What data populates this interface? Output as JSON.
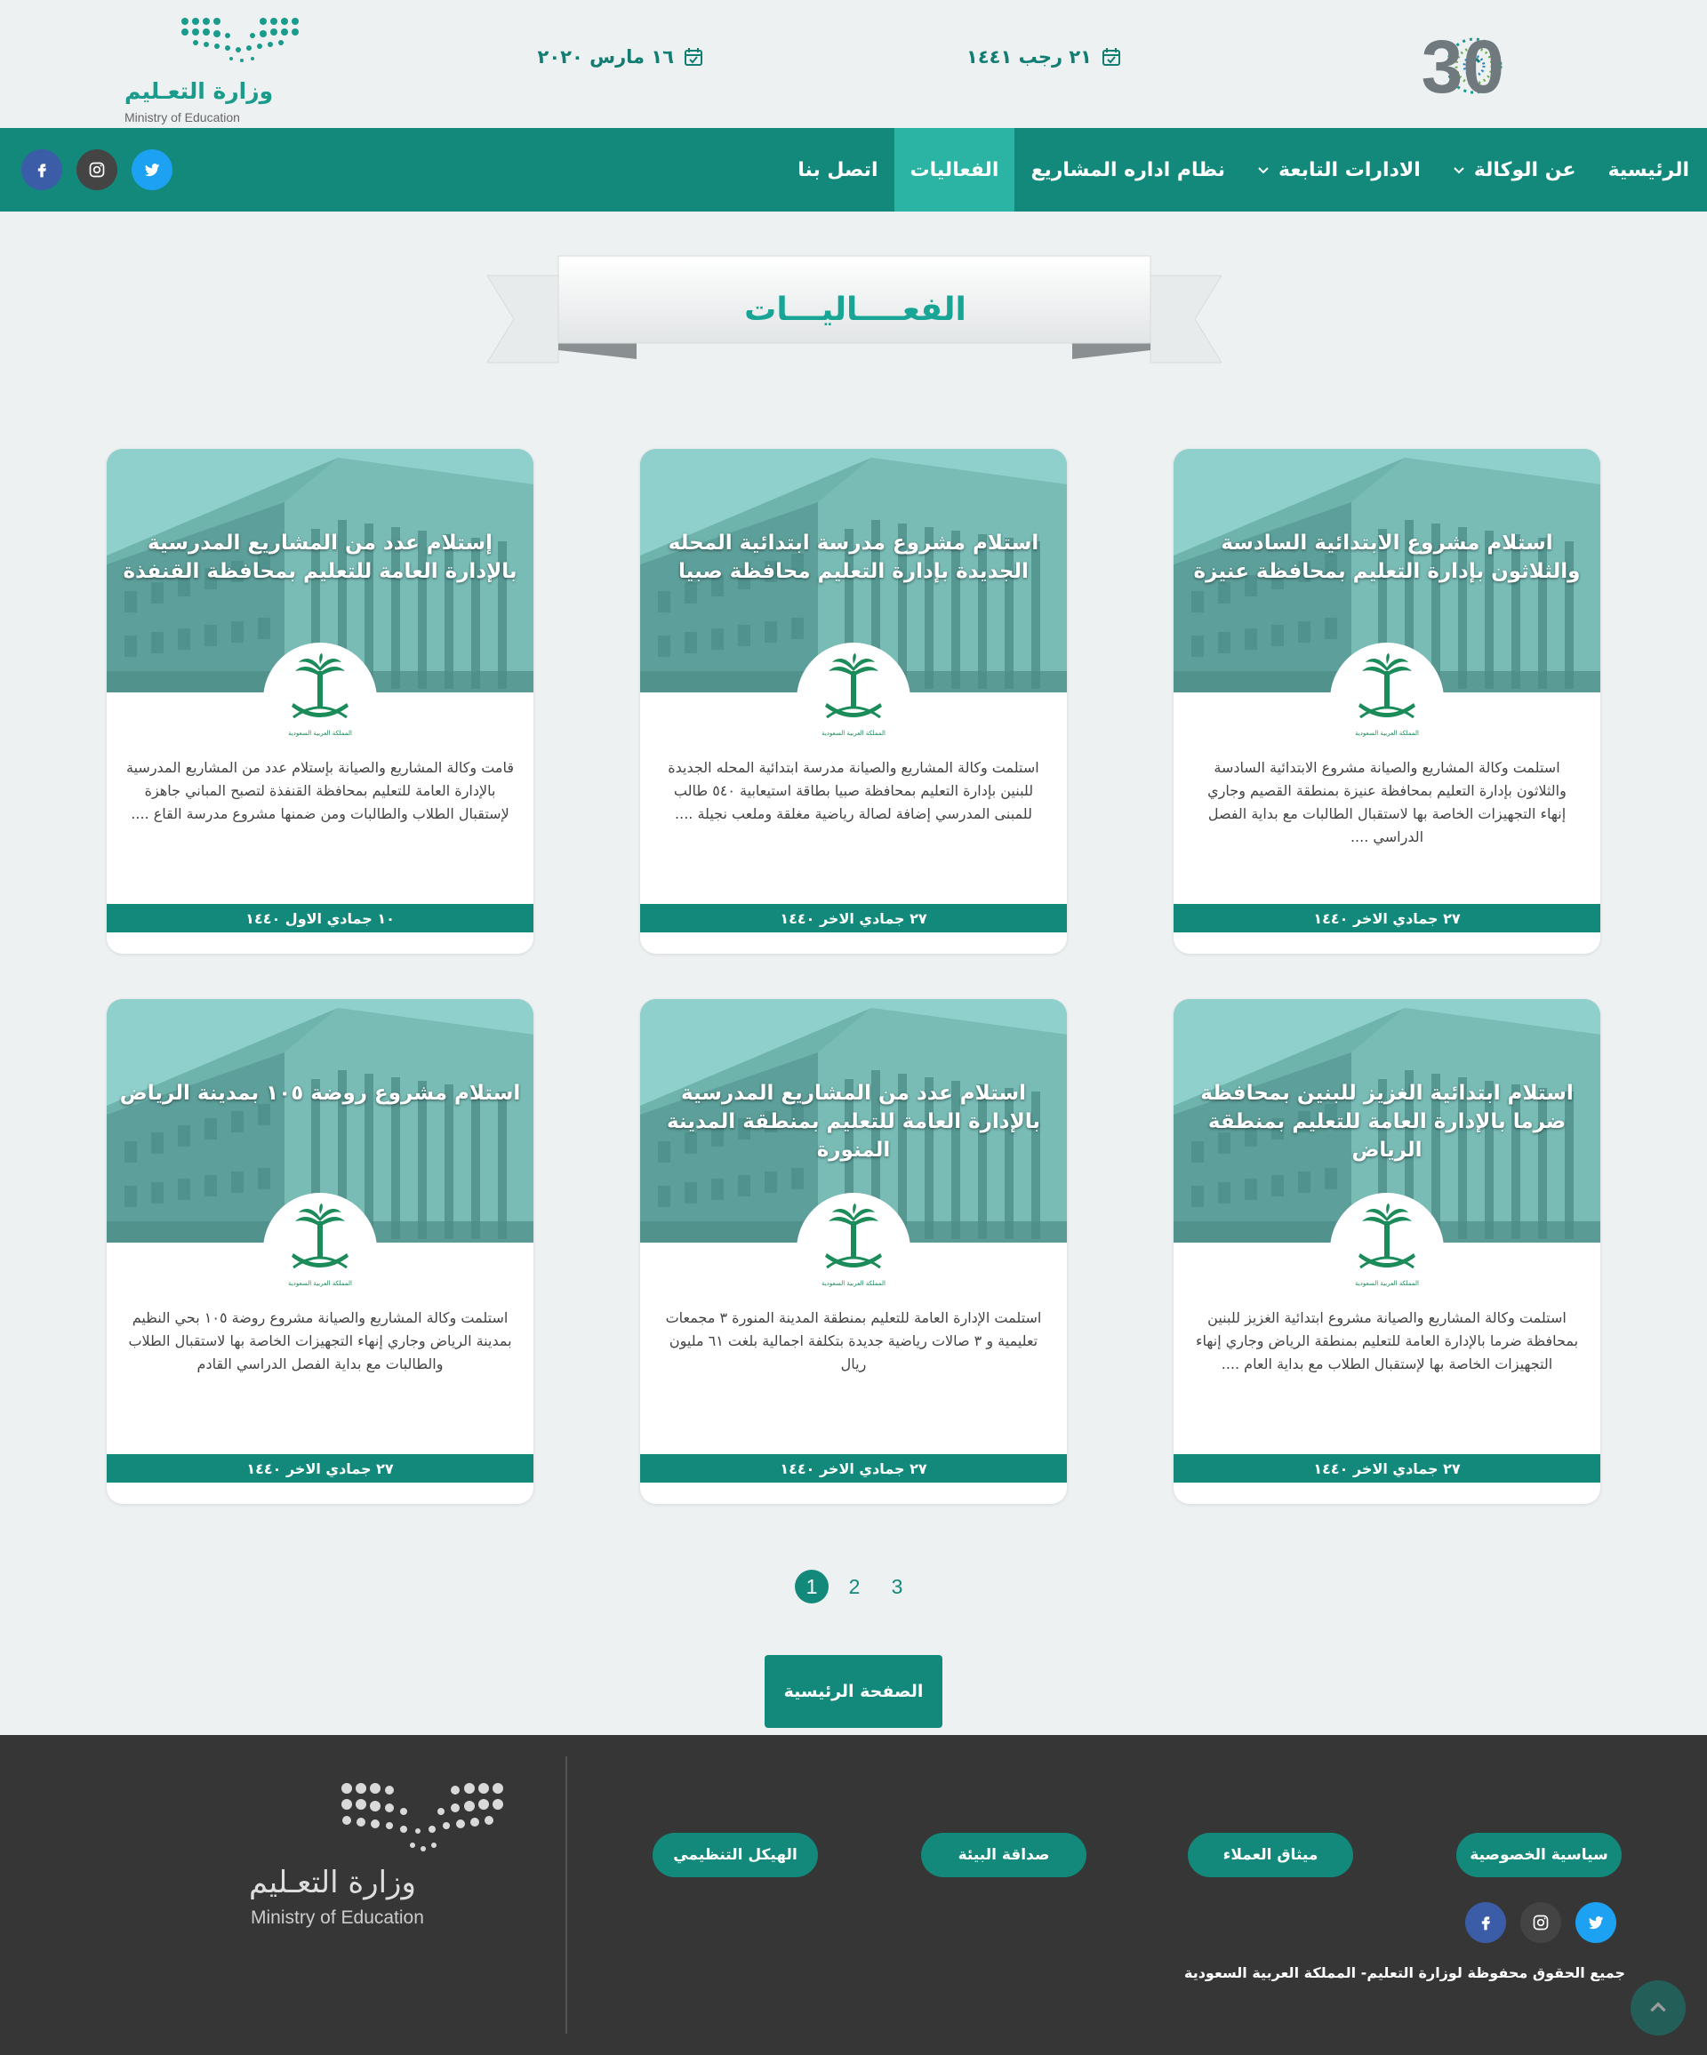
{
  "header": {
    "hijri_date": "٢١ رجب ١٤٤١",
    "gregorian_date": "١٦ مارس ٢٠٢٠",
    "vision_logo_text": "2030",
    "ministry_logo_ar": "وزارة التعـليم",
    "ministry_logo_en": "Ministry of Education"
  },
  "nav": {
    "items": [
      {
        "label": "الرئيسية",
        "has_dropdown": false,
        "active": false
      },
      {
        "label": "عن الوكالة",
        "has_dropdown": true,
        "active": false
      },
      {
        "label": "الادارات التابعة",
        "has_dropdown": true,
        "active": false
      },
      {
        "label": "نظام اداره المشاريع",
        "has_dropdown": false,
        "active": false
      },
      {
        "label": "الفعاليات",
        "has_dropdown": false,
        "active": true
      },
      {
        "label": "اتصل بنا",
        "has_dropdown": false,
        "active": false
      }
    ],
    "social": [
      "twitter-icon",
      "instagram-icon",
      "facebook-icon"
    ]
  },
  "page_title": "الفعــــاليـــات",
  "cards": [
    {
      "title": "استلام مشروع الابتدائية السادسة والثلاثون بإدارة التعليم بمحافظة عنيزة",
      "body": "استلمت وكالة المشاريع والصيانة مشروع الابتدائية السادسة والثلاثون بإدارة التعليم بمحافظة عنيزة بمنطقة القصيم وجاري إنهاء التجهيزات الخاصة بها لاستقبال الطالبات مع بداية الفصل الدراسي ....",
      "date": "٢٧ جمادي الاخر ١٤٤٠"
    },
    {
      "title": "استلام مشروع مدرسة ابتدائية المحله الجديدة بإدارة التعليم محافظة صبيا",
      "body": "استلمت وكالة المشاريع والصيانة مدرسة ابتدائية المحله الجديدة للبنين بإدارة التعليم بمحافظة صبيا بطاقة استيعابية ٥٤٠ طالب للمبنى المدرسي إضافة لصالة رياضية مغلقة وملعب نجيلة ....",
      "date": "٢٧ جمادي الاخر ١٤٤٠"
    },
    {
      "title": "إستلام عدد من المشاريع المدرسية بالإدارة العامة للتعليم بمحافظة القنفذة",
      "body": "قامت وكالة المشاريع والصيانة بإستلام عدد من المشاريع المدرسية بالإدارة العامة للتعليم بمحافظة القنفذة لتصبح المباني جاهزة لإستقبال الطلاب والطالبات ومن ضمنها مشروع مدرسة القاع ....",
      "date": "١٠ جمادي الاول ١٤٤٠"
    },
    {
      "title": "استلام ابتدائية الغزيز للبنين بمحافظة ضرما بالإدارة العامة للتعليم بمنطقة الرياض",
      "body": "استلمت وكالة المشاريع والصيانة مشروع ابتدائية الغزيز للبنين بمحافظة ضرما بالإدارة العامة للتعليم بمنطقة الرياض وجاري إنهاء التجهيزات الخاصة بها لإستقبال الطلاب مع بداية العام ....",
      "date": "٢٧ جمادي الاخر ١٤٤٠"
    },
    {
      "title": "استلام عدد من المشاريع المدرسية بالإدارة العامة للتعليم بمنطقة المدينة المنورة",
      "body": "استلمت الإدارة العامة للتعليم بمنطقة المدينة المنورة ٣ مجمعات تعليمية و ٣ صالات رياضية جديدة بتكلفة اجمالية بلغت ٦١ مليون ريال",
      "date": "٢٧ جمادي الاخر ١٤٤٠"
    },
    {
      "title": "استلام مشروع روضة ١٠٥ بمدينة الرياض",
      "body": "استلمت وكالة المشاريع والصيانة مشروع روضة ١٠٥ بحي النظيم بمدينة الرياض وجاري إنهاء التجهيزات الخاصة بها لاستقبال الطلاب والطالبات مع بداية الفصل الدراسي القادم",
      "date": "٢٧ جمادي الاخر ١٤٤٠"
    }
  ],
  "emblem_caption": "المملكة العربية السعودية",
  "pagination": {
    "pages": [
      "1",
      "2",
      "3"
    ],
    "current": "1"
  },
  "home_button": "الصفحة الرئيسية",
  "footer": {
    "links": [
      "سياسية الخصوصية",
      "ميثاق العملاء",
      "صداقة البيئة",
      "الهيكل التنظيمي"
    ],
    "copyright": "جميع الحقوق محفوظة لوزارة التعليم- المملكة العربية السعودية",
    "logo_ar": "وزارة التعـليم",
    "logo_en": "Ministry of Education"
  },
  "colors": {
    "primary": "#12897a",
    "active_tab": "#2bb3a4",
    "title": "#19a596",
    "footer_bg": "#363636",
    "page_bg": "#eef1f2"
  }
}
